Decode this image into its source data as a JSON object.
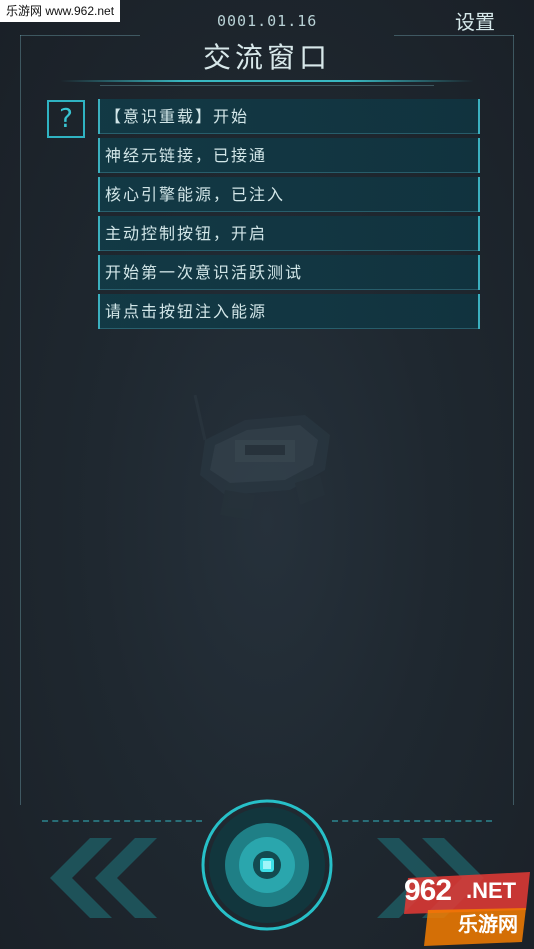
{
  "watermark": {
    "site_url": "乐游网 www.962.net",
    "logo_num": "962",
    "logo_net": ".NET",
    "logo_cn": "乐游网"
  },
  "header": {
    "date": "0001.01.16",
    "settings_label": "设置",
    "title": "交流窗口"
  },
  "help_button": {
    "icon": "question-mark-icon",
    "symbol": "?"
  },
  "messages": [
    {
      "text": "【意识重载】开始"
    },
    {
      "text": "神经元链接，已接通"
    },
    {
      "text": "核心引擎能源，已注入"
    },
    {
      "text": "主动控制按钮，开启"
    },
    {
      "text": "开始第一次意识活跃测试"
    },
    {
      "text": "请点击按钮注入能源"
    }
  ],
  "controls": {
    "left_arrow_icon": "double-chevron-left-icon",
    "right_arrow_icon": "double-chevron-right-icon",
    "main_button_icon": "energy-core-button-icon"
  },
  "colors": {
    "accent": "#2fb3c2",
    "background": "#1f2830",
    "message_bg": "#123a46",
    "text": "#d2e6e8"
  }
}
